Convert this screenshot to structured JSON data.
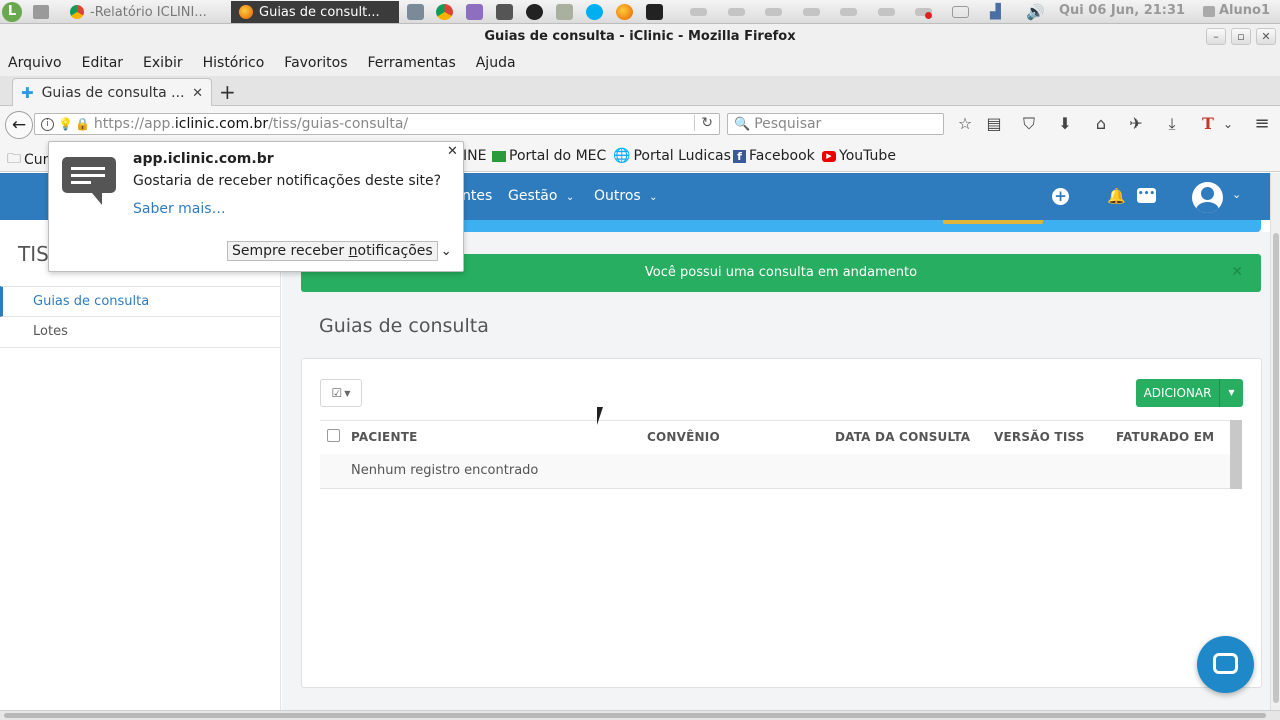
{
  "taskbar": {
    "tasks": [
      {
        "label": "-Relatório ICLINI..."
      },
      {
        "label": "Guias de consult..."
      }
    ],
    "clock": "Qui 06 Jun, 21:31",
    "user": "Aluno1"
  },
  "window": {
    "title": "Guias de consulta - iClinic - Mozilla Firefox"
  },
  "menu": [
    "Arquivo",
    "Editar",
    "Exibir",
    "Histórico",
    "Favoritos",
    "Ferramentas",
    "Ajuda"
  ],
  "tab": {
    "label": "Guias de consulta ..."
  },
  "url": {
    "prefix": "https://app.",
    "domain": "iclinic.com.br",
    "path": "/tiss/guias-consulta/"
  },
  "search": {
    "placeholder": "Pesquisar"
  },
  "bookmarks": [
    "Cur",
    "INE",
    "Portal do MEC",
    "Portal Ludicas",
    "Facebook",
    "YouTube"
  ],
  "popup": {
    "site": "app.iclinic.com.br",
    "message": "Gostaria de receber notificações deste site?",
    "learn_more": "Saber mais…",
    "action_pre": "Sempre receber ",
    "action_u": "n",
    "action_post": "otificações"
  },
  "app": {
    "nav": [
      "ntes",
      "Gestão",
      "Outros"
    ],
    "section_title": "TIS",
    "sidebar": [
      "Guias de consulta",
      "Lotes"
    ],
    "alert": "Você possui uma consulta em andamento",
    "page_title": "Guias de consulta",
    "add_button": "ADICIONAR",
    "columns": [
      "PACIENTE",
      "CONVÊNIO",
      "DATA DA CONSULTA",
      "VERSÃO TISS",
      "FATURADO EM"
    ],
    "empty": "Nenhum registro encontrado"
  },
  "colors": {
    "brand_blue": "#2e7cbe",
    "success_green": "#27ae60",
    "info_blue": "#3cb0f0",
    "link": "#2e7cbe"
  }
}
